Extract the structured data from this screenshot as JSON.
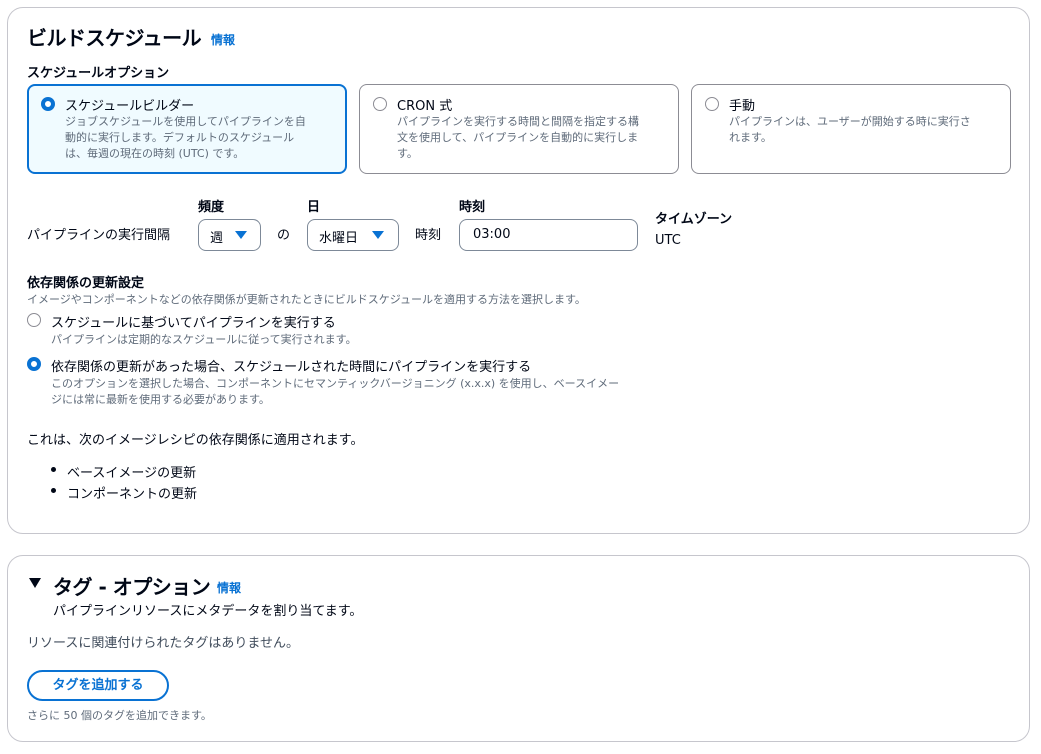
{
  "schedule": {
    "title": "ビルドスケジュール",
    "info": "情報",
    "options_label": "スケジュールオプション",
    "tiles": [
      {
        "title": "スケジュールビルダー",
        "desc1": "ジョブスケジュールを使用してパイプラインを自",
        "desc2": "動的に実行します。デフォルトのスケジュール",
        "desc3": "は、毎週の現在の時刻 (UTC) です。",
        "selected": true
      },
      {
        "title": "CRON 式",
        "desc1": "パイプラインを実行する時間と間隔を指定する構",
        "desc2": "文を使用して、パイプラインを自動的に実行しま",
        "desc3": "す。",
        "selected": false
      },
      {
        "title": "手動",
        "desc1": "パイプラインは、ユーザーが開始する時に実行さ",
        "desc2": "れます。",
        "selected": false
      }
    ],
    "interval_label": "パイプラインの実行間隔",
    "frequency_label": "頻度",
    "frequency_value": "週",
    "of_text": "の",
    "day_label": "日",
    "day_value": "水曜日",
    "time_suffix": "時刻",
    "time_label": "時刻",
    "time_value": "03:00",
    "timezone_label": "タイムゾーン",
    "timezone_value": "UTC"
  },
  "dependency": {
    "title": "依存関係の更新設定",
    "desc": "イメージやコンポーネントなどの依存関係が更新されたときにビルドスケジュールを適用する方法を選択します。",
    "options": [
      {
        "label": "スケジュールに基づいてパイプラインを実行する",
        "desc1": "パイプラインは定期的なスケジュールに従って実行されます。",
        "selected": false
      },
      {
        "label": "依存関係の更新があった場合、スケジュールされた時間にパイプラインを実行する",
        "desc1": "このオプションを選択した場合、コンポーネントにセマンティックバージョニング (x.x.x) を使用し、ベースイメー",
        "desc2": "ジには常に最新を使用する必要があります。",
        "selected": true
      }
    ],
    "applies_text": "これは、次のイメージレシピの依存関係に適用されます。",
    "bullets": [
      "ベースイメージの更新",
      "コンポーネントの更新"
    ]
  },
  "tags": {
    "title": "タグ - オプション",
    "info": "情報",
    "subtitle": "パイプラインリソースにメタデータを割り当てます。",
    "empty_text": "リソースに関連付けられたタグはありません。",
    "add_button": "タグを追加する",
    "limit_text": "さらに 50 個のタグを追加できます。"
  },
  "colors": {
    "accent": "#0972d3",
    "text": "#000716",
    "secondary": "#5f6b7a",
    "border": "#c6c6cd"
  }
}
